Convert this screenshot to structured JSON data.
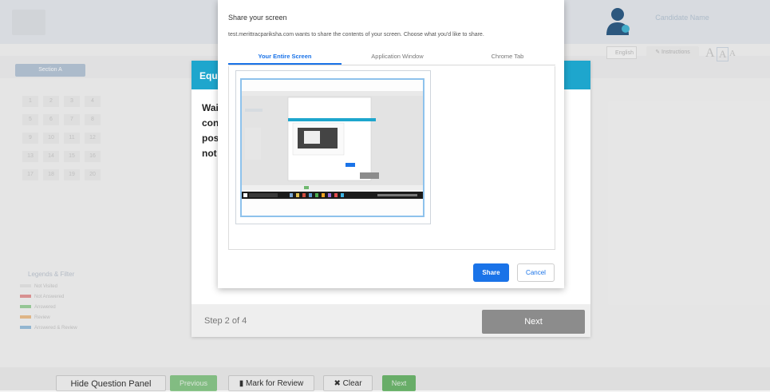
{
  "background": {
    "user_name": "Candidate Name",
    "section_tab": "Section A",
    "language_select": "English",
    "instructions_label": "Instructions",
    "font_sizes": [
      "A",
      "A",
      "A"
    ],
    "question_numbers": [
      "1",
      "2",
      "3",
      "4",
      "5",
      "6",
      "7",
      "8",
      "9",
      "10",
      "11",
      "12",
      "13",
      "14",
      "15",
      "16",
      "17",
      "18",
      "19",
      "20"
    ],
    "legend_title": "Legends & Filter",
    "legend_items": [
      {
        "label": "Not Visited",
        "color": "#e6e6e6"
      },
      {
        "label": "Not Answered",
        "color": "#e59a9a"
      },
      {
        "label": "Answered",
        "color": "#9fd39f"
      },
      {
        "label": "Review",
        "color": "#ecc18f"
      },
      {
        "label": "Answered & Review",
        "color": "#9cc1dd"
      }
    ]
  },
  "bottom_bar": {
    "hide_panel": "Hide Question Panel",
    "previous": "Previous",
    "mark_review": "Mark for Review",
    "clear": "Clear",
    "next": "Next"
  },
  "tour": {
    "title": "Equ",
    "body_lines": [
      "Wai",
      "con",
      "pos",
      "not"
    ],
    "step_text": "Step 2 of 4",
    "next_label": "Next"
  },
  "share_dialog": {
    "title": "Share your screen",
    "subtitle": "test.merittracpariksha.com wants to share the contents of your screen. Choose what you'd like to share.",
    "tabs": [
      "Your Entire Screen",
      "Application Window",
      "Chrome Tab"
    ],
    "active_tab": "Your Entire Screen",
    "share_label": "Share",
    "cancel_label": "Cancel"
  },
  "colors": {
    "tour_header": "#1ea6cd",
    "share_blue": "#1a73e8",
    "previous_bg": "#8bc88b",
    "next_bg": "#6fb86f"
  },
  "icons": [
    "user-avatar-icon",
    "bookmark-icon",
    "close-x-icon",
    "pencil-icon"
  ]
}
